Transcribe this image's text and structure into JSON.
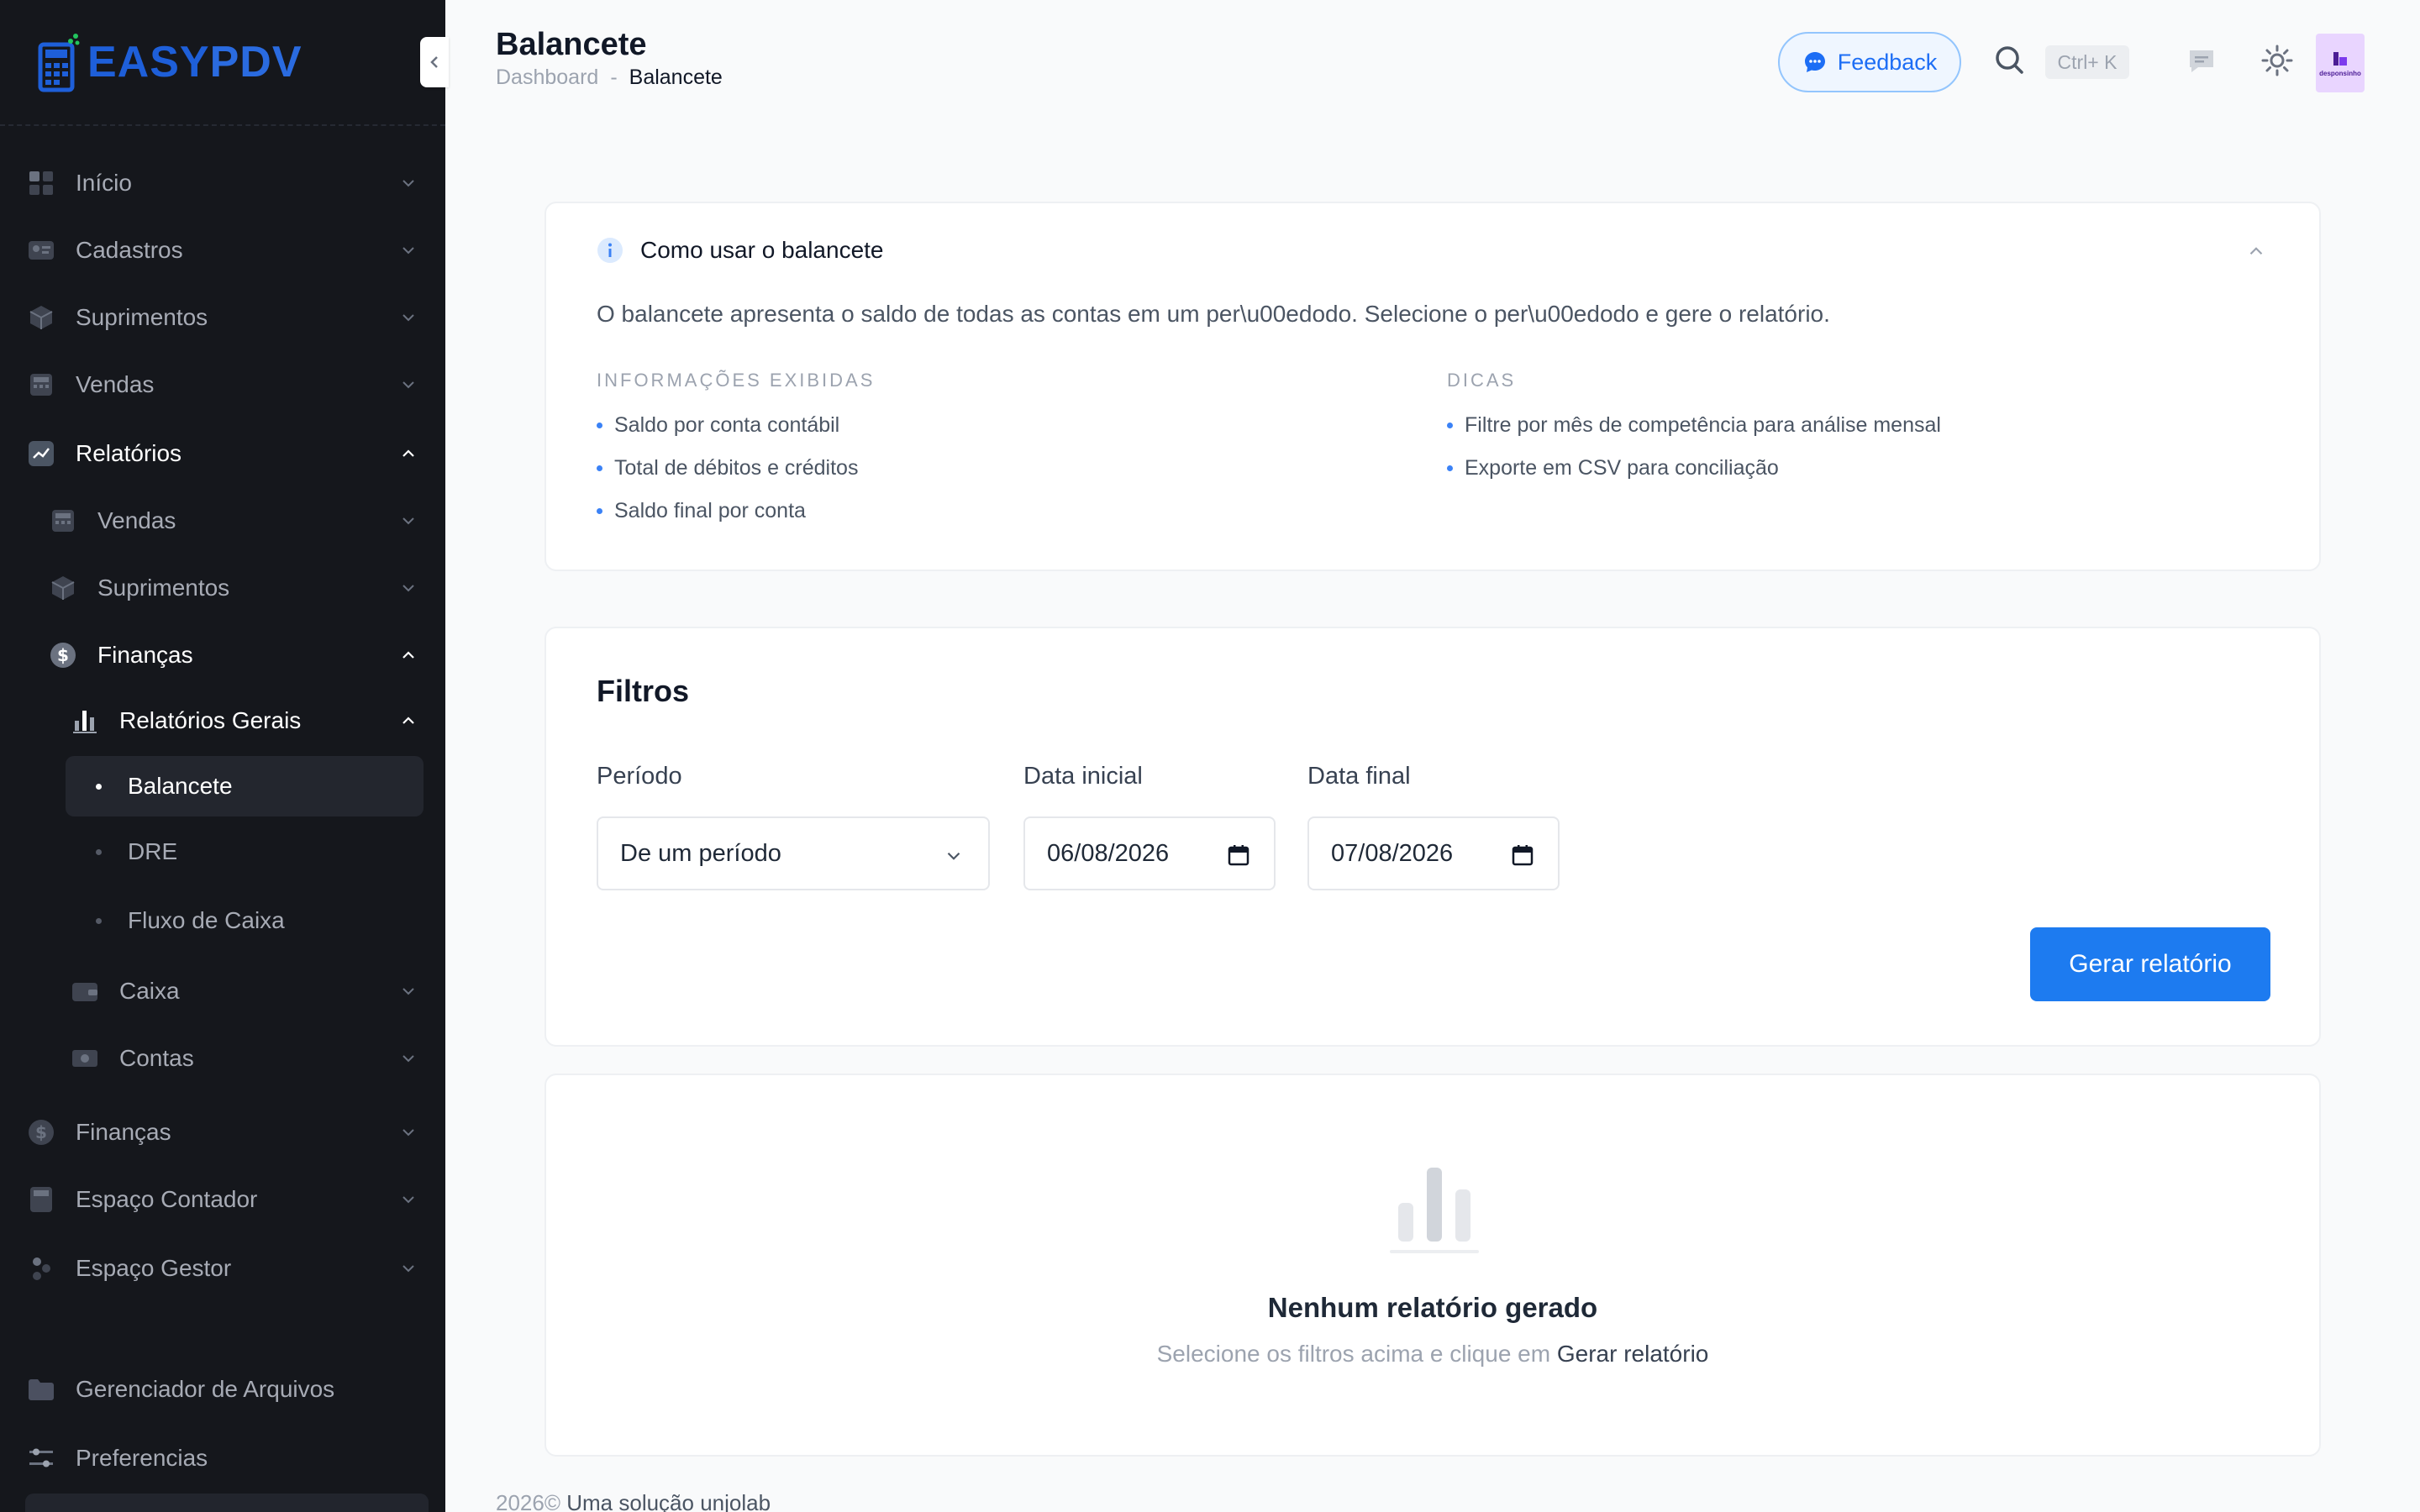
{
  "brand": {
    "logo_text_a": "EASY",
    "logo_text_b": "PDV"
  },
  "sidebar": {
    "items": [
      {
        "label": "Início",
        "icon": "grid-icon"
      },
      {
        "label": "Cadastros",
        "icon": "id-card-icon"
      },
      {
        "label": "Suprimentos",
        "icon": "box-icon"
      },
      {
        "label": "Vendas",
        "icon": "register-icon"
      },
      {
        "label": "Relatórios",
        "icon": "chart-line-icon"
      },
      {
        "label": "Vendas",
        "icon": "register-icon"
      },
      {
        "label": "Suprimentos",
        "icon": "box-icon"
      },
      {
        "label": "Finanças",
        "icon": "dollar-icon"
      },
      {
        "label": "Relatórios Gerais",
        "icon": "bar-chart-icon"
      },
      {
        "label": "Balancete"
      },
      {
        "label": "DRE"
      },
      {
        "label": "Fluxo de Caixa"
      },
      {
        "label": "Caixa",
        "icon": "wallet-icon"
      },
      {
        "label": "Contas",
        "icon": "money-icon"
      },
      {
        "label": "Finanças",
        "icon": "dollar-icon"
      },
      {
        "label": "Espaço Contador",
        "icon": "calculator-icon"
      },
      {
        "label": "Espaço Gestor",
        "icon": "users-icon"
      },
      {
        "label": "Gerenciador de Arquivos",
        "icon": "folder-icon"
      },
      {
        "label": "Preferencias",
        "icon": "sliders-icon"
      }
    ]
  },
  "header": {
    "title": "Balancete",
    "breadcrumb": {
      "parent": "Dashboard",
      "separator": "-",
      "current": "Balancete"
    },
    "feedback_label": "Feedback",
    "shortcut": "Ctrl+ K",
    "avatar_text": "desponsinho"
  },
  "help_card": {
    "title": "Como usar o balancete",
    "description": "O balancete apresenta o saldo de todas as contas em um per\\u00edodo. Selecione o per\\u00edodo e gere o relatório.",
    "col1": {
      "heading": "INFORMAÇÕES EXIBIDAS",
      "items": [
        "Saldo por conta contábil",
        "Total de débitos e créditos",
        "Saldo final por conta"
      ]
    },
    "col2": {
      "heading": "DICAS",
      "items": [
        "Filtre por mês de competência para análise mensal",
        "Exporte em CSV para conciliação"
      ]
    }
  },
  "filters": {
    "title": "Filtros",
    "period_label": "Período",
    "period_value": "De um período",
    "start_label": "Data inicial",
    "start_value": "06/08/2026",
    "end_label": "Data final",
    "end_value": "07/08/2026",
    "generate_label": "Gerar relatório"
  },
  "empty": {
    "title": "Nenhum relatório gerado",
    "subtitle": "Selecione os filtros acima e clique em",
    "subtitle_emphasis": "Gerar relatório"
  },
  "footer": {
    "year": "2026©",
    "brand": "Uma solução unjolab"
  },
  "colors": {
    "accent": "#1d7bf0",
    "sidebar_bg": "#15171c",
    "logo_blue": "#1e5fd9"
  }
}
